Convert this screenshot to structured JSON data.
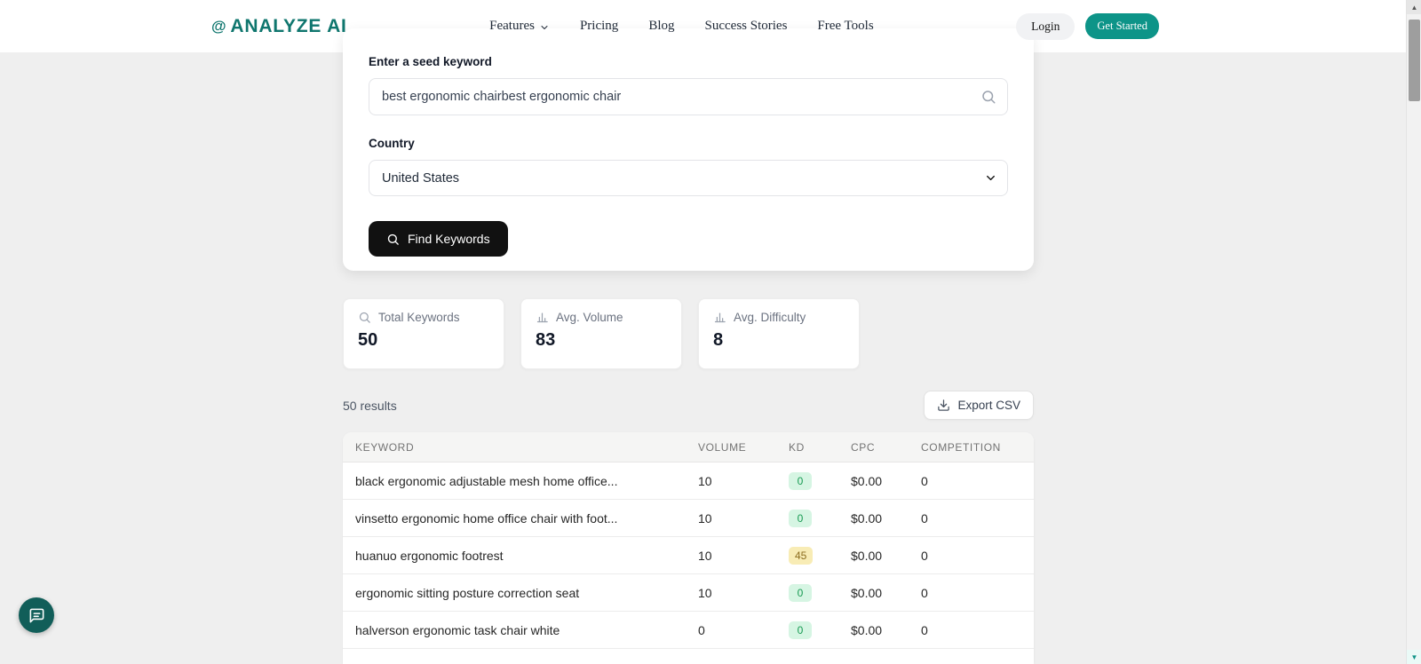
{
  "colors": {
    "brand_teal": "#0d9488",
    "logo_teal": "#0f766e",
    "find_button_black": "#111111",
    "kd_green_bg": "#d6f5e3",
    "kd_green_text": "#179a52",
    "kd_yellow_bg": "#f8ecb5",
    "kd_yellow_text": "#8c6d1f",
    "page_background": "#efefef"
  },
  "nav": {
    "logo_icon": "@",
    "logo_text": "ANALYZE AI",
    "items": [
      {
        "label": "Features"
      },
      {
        "label": "Pricing"
      },
      {
        "label": "Blog"
      },
      {
        "label": "Success Stories"
      },
      {
        "label": "Free Tools"
      }
    ],
    "login_label": "Login",
    "get_started_label": "Get Started"
  },
  "search_card": {
    "keyword_label": "Enter a seed keyword",
    "keyword_value": "best ergonomic chairbest ergonomic chair",
    "country_label": "Country",
    "country_value": "United States",
    "find_button_label": "Find Keywords"
  },
  "stats": [
    {
      "icon": "search-icon",
      "label": "Total Keywords",
      "value": "50"
    },
    {
      "icon": "bar-chart-icon",
      "label": "Avg. Volume",
      "value": "83"
    },
    {
      "icon": "bar-chart-icon",
      "label": "Avg. Difficulty",
      "value": "8"
    }
  ],
  "results": {
    "count_text": "50 results",
    "export_label": "Export CSV"
  },
  "table": {
    "headers": [
      "KEYWORD",
      "VOLUME",
      "KD",
      "CPC",
      "COMPETITION"
    ],
    "rows": [
      {
        "keyword": "black ergonomic adjustable mesh home office...",
        "volume": "10",
        "kd": "0",
        "kd_level": "green",
        "cpc": "$0.00",
        "competition": "0"
      },
      {
        "keyword": "vinsetto ergonomic home office chair with foot...",
        "volume": "10",
        "kd": "0",
        "kd_level": "green",
        "cpc": "$0.00",
        "competition": "0"
      },
      {
        "keyword": "huanuo ergonomic footrest",
        "volume": "10",
        "kd": "45",
        "kd_level": "yellow",
        "cpc": "$0.00",
        "competition": "0"
      },
      {
        "keyword": "ergonomic sitting posture correction seat",
        "volume": "10",
        "kd": "0",
        "kd_level": "green",
        "cpc": "$0.00",
        "competition": "0"
      },
      {
        "keyword": "halverson ergonomic task chair white",
        "volume": "0",
        "kd": "0",
        "kd_level": "green",
        "cpc": "$0.00",
        "competition": "0"
      }
    ]
  }
}
